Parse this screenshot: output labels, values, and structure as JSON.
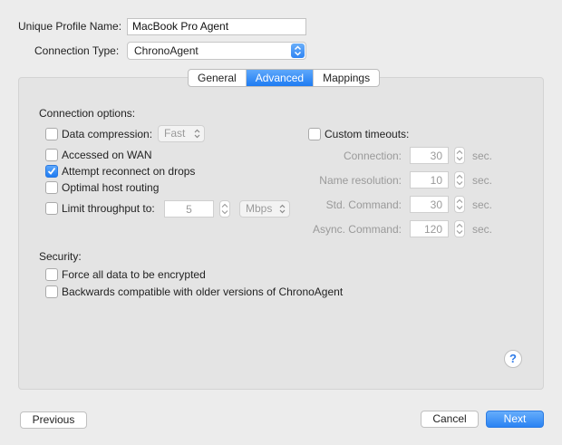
{
  "profile": {
    "label": "Unique Profile Name:",
    "value": "MacBook Pro Agent"
  },
  "connection_type": {
    "label": "Connection Type:",
    "value": "ChronoAgent"
  },
  "tabs": [
    {
      "label": "General"
    },
    {
      "label": "Advanced"
    },
    {
      "label": "Mappings"
    }
  ],
  "active_tab": "Advanced",
  "connection_options": {
    "heading": "Connection options:",
    "data_compression": {
      "label": "Data compression:",
      "checked": false,
      "value": "Fast"
    },
    "accessed_on_wan": {
      "label": "Accessed on WAN",
      "checked": false
    },
    "attempt_reconnect": {
      "label": "Attempt reconnect on drops",
      "checked": true
    },
    "optimal_routing": {
      "label": "Optimal host routing",
      "checked": false
    },
    "limit_throughput": {
      "label": "Limit throughput to:",
      "checked": false,
      "value": "5",
      "unit": "Mbps"
    }
  },
  "timeouts": {
    "label": "Custom timeouts:",
    "checked": false,
    "unit": "sec.",
    "rows": [
      {
        "label": "Connection:",
        "value": "30"
      },
      {
        "label": "Name resolution:",
        "value": "10"
      },
      {
        "label": "Std. Command:",
        "value": "30"
      },
      {
        "label": "Async. Command:",
        "value": "120"
      }
    ]
  },
  "security": {
    "heading": "Security:",
    "force_encrypt": {
      "label": "Force all data to be encrypted",
      "checked": false
    },
    "backwards_compat": {
      "label": "Backwards compatible with older versions of ChronoAgent",
      "checked": false
    }
  },
  "help_label": "?",
  "buttons": {
    "previous": "Previous",
    "cancel": "Cancel",
    "next": "Next"
  },
  "colors": {
    "accent": "#1e7bf2",
    "panel": "#e4e4e4",
    "window": "#ececec"
  }
}
